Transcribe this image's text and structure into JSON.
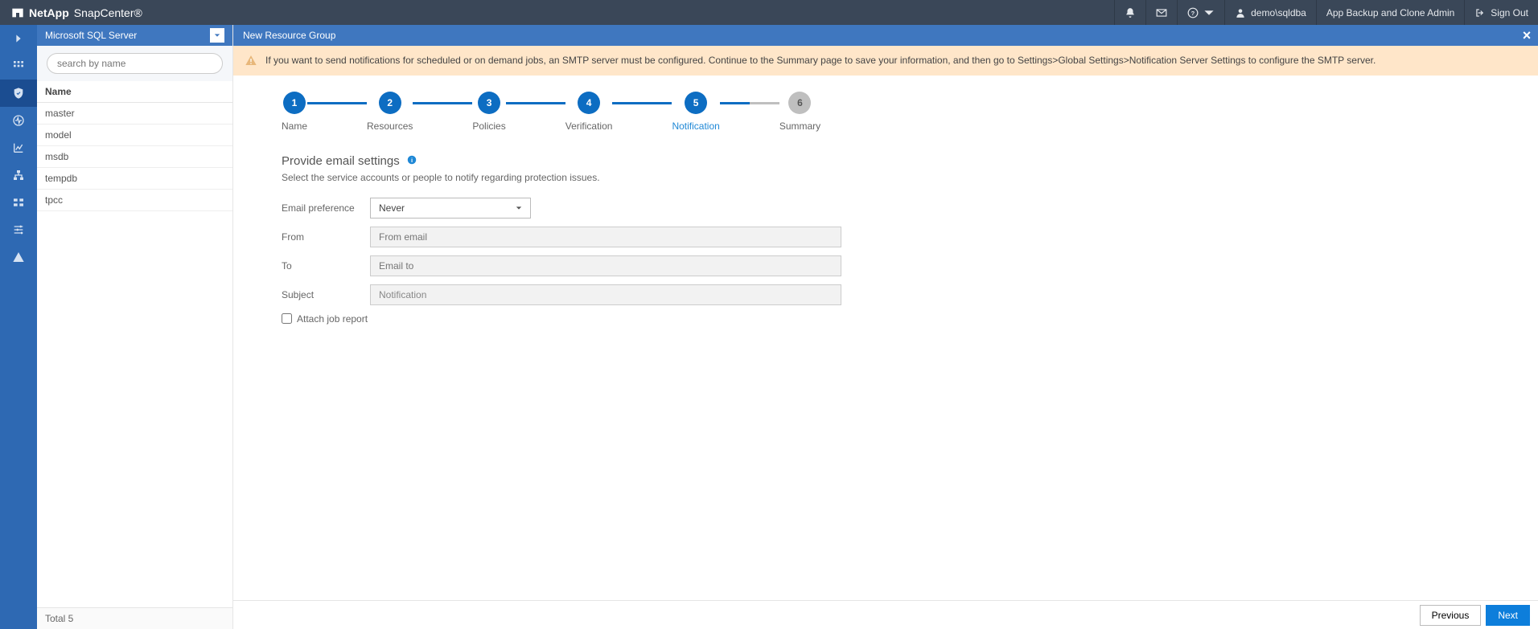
{
  "topbar": {
    "brand": "NetApp",
    "product": "SnapCenter®",
    "user": "demo\\sqldba",
    "role": "App Backup and Clone Admin",
    "signout": "Sign Out"
  },
  "resourcePanel": {
    "tree_label": "Microsoft SQL Server",
    "search_placeholder": "search by name",
    "header": "Name",
    "items": [
      "master",
      "model",
      "msdb",
      "tempdb",
      "tpcc"
    ],
    "footer": "Total 5"
  },
  "subheader": {
    "title": "New Resource Group"
  },
  "infobar": {
    "text": "If you want to send notifications for scheduled or on demand jobs, an SMTP server must be configured. Continue to the Summary page to save your information, and then go to Settings>Global Settings>Notification Server Settings to configure the SMTP server."
  },
  "wizard": {
    "steps": [
      {
        "n": "1",
        "label": "Name"
      },
      {
        "n": "2",
        "label": "Resources"
      },
      {
        "n": "3",
        "label": "Policies"
      },
      {
        "n": "4",
        "label": "Verification"
      },
      {
        "n": "5",
        "label": "Notification"
      },
      {
        "n": "6",
        "label": "Summary"
      }
    ]
  },
  "section": {
    "title": "Provide email settings",
    "desc": "Select the service accounts or people to notify regarding protection issues.",
    "labels": {
      "emailpref": "Email preference",
      "from": "From",
      "to": "To",
      "subject": "Subject",
      "attach": "Attach job report"
    },
    "values": {
      "emailpref": "Never",
      "subject": "Notification"
    },
    "placeholders": {
      "from": "From email",
      "to": "Email to"
    }
  },
  "footer": {
    "previous": "Previous",
    "next": "Next"
  }
}
